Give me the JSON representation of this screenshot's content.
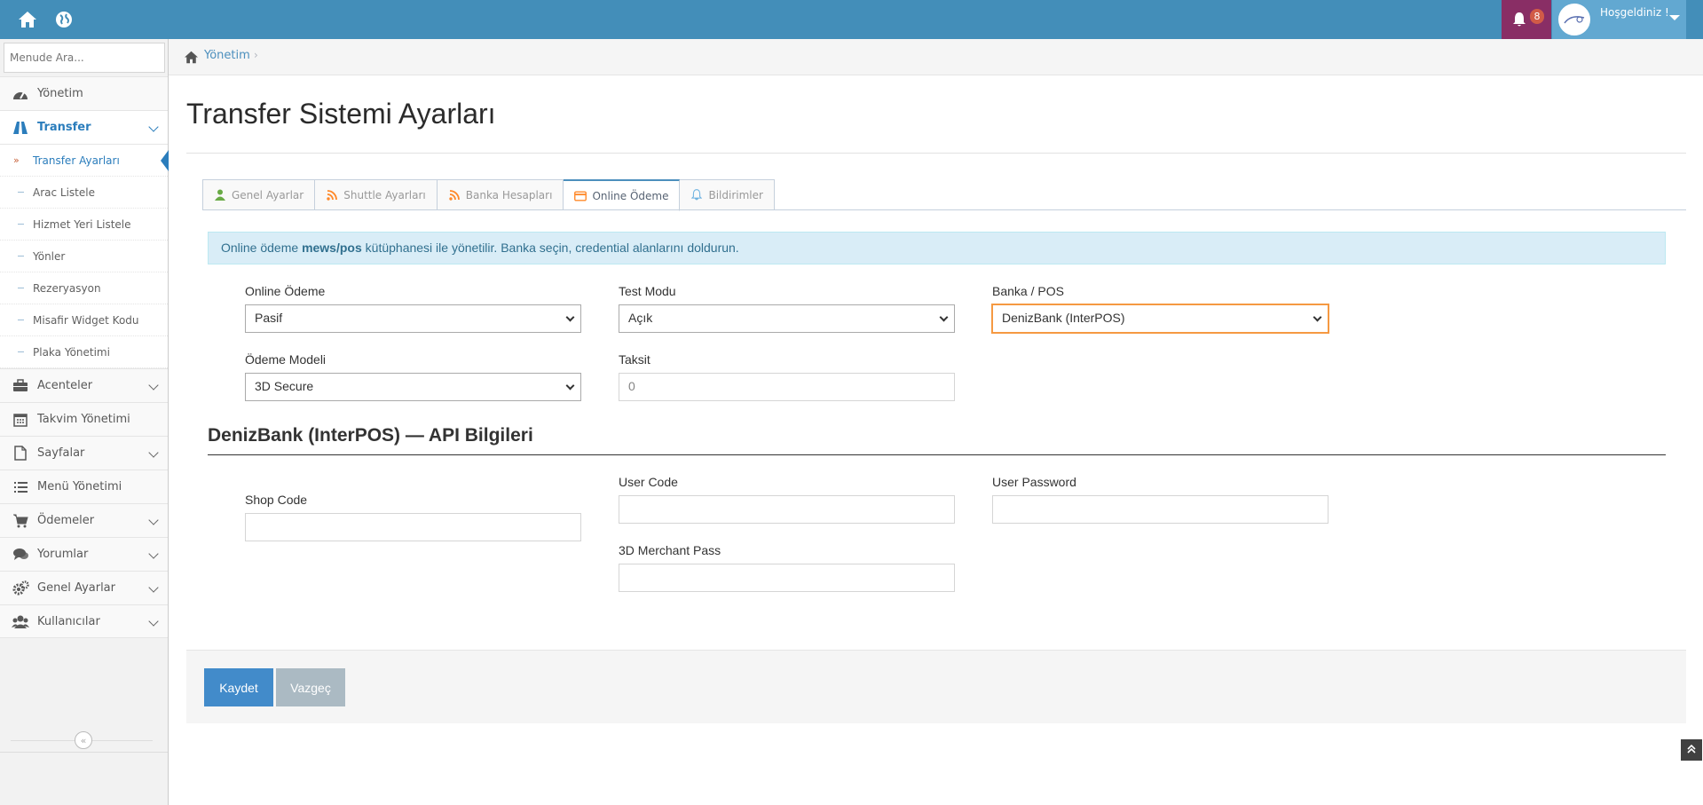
{
  "colors": {
    "navbar": "#438eb9",
    "notification_bg": "#892e65",
    "user_bg": "#62a8d1",
    "accent": "#2b7dbc",
    "alert_bg": "#d9edf7",
    "save_button": "#428bca",
    "cancel_button": "#abbac3"
  },
  "navbar": {
    "home_icon": "home-icon",
    "globe_icon": "globe-icon",
    "notification_count": "8",
    "welcome_text": "Hoşgeldiniz !"
  },
  "sidebar": {
    "search_placeholder": "Menude Ara...",
    "items": [
      {
        "label": "Yönetim",
        "icon": "dashboard-icon"
      },
      {
        "label": "Transfer",
        "icon": "road-icon",
        "active": true
      },
      {
        "label": "Acenteler",
        "icon": "briefcase-icon"
      },
      {
        "label": "Takvim Yönetimi",
        "icon": "calendar-icon"
      },
      {
        "label": "Sayfalar",
        "icon": "file-icon"
      },
      {
        "label": "Menü Yönetimi",
        "icon": "list-icon"
      },
      {
        "label": "Ödemeler",
        "icon": "cart-icon"
      },
      {
        "label": "Yorumlar",
        "icon": "comments-icon"
      },
      {
        "label": "Genel Ayarlar",
        "icon": "cogs-icon"
      },
      {
        "label": "Kullanıcılar",
        "icon": "users-icon"
      }
    ],
    "submenu": [
      {
        "label": "Transfer Ayarları",
        "current": true
      },
      {
        "label": "Arac Listele"
      },
      {
        "label": "Hizmet Yeri Listele"
      },
      {
        "label": "Yönler"
      },
      {
        "label": "Rezeryasyon"
      },
      {
        "label": "Misafir Widget Kodu"
      },
      {
        "label": "Plaka Yönetimi"
      }
    ]
  },
  "breadcrumb": {
    "link": "Yönetim",
    "separator": "›"
  },
  "page": {
    "title": "Transfer Sistemi Ayarları"
  },
  "tabs": [
    {
      "label": "Genel Ayarlar",
      "icon": "user-icon"
    },
    {
      "label": "Shuttle Ayarları",
      "icon": "rss-icon"
    },
    {
      "label": "Banka Hesapları",
      "icon": "rss-icon"
    },
    {
      "label": "Online Ödeme",
      "icon": "credit-card-icon",
      "active": true
    },
    {
      "label": "Bildirimler",
      "icon": "bell-icon"
    }
  ],
  "alert": {
    "prefix": "Online ödeme ",
    "library": "mews/pos",
    "suffix": " kütüphanesi ile yönetilir. Banka seçin, credential alanlarını doldurun."
  },
  "form": {
    "online_payment": {
      "label": "Online Ödeme",
      "value": "Pasif"
    },
    "test_mode": {
      "label": "Test Modu",
      "value": "Açık"
    },
    "bank_pos": {
      "label": "Banka / POS",
      "value": "DenizBank (InterPOS)"
    },
    "payment_model": {
      "label": "Ödeme Modeli",
      "value": "3D Secure"
    },
    "installment": {
      "label": "Taksit",
      "value": "0"
    },
    "api_section_title": "DenizBank (InterPOS) — API Bilgileri",
    "shop_code": {
      "label": "Shop Code",
      "value": ""
    },
    "user_code": {
      "label": "User Code",
      "value": ""
    },
    "user_password": {
      "label": "User Password",
      "value": ""
    },
    "merchant_pass": {
      "label": "3D Merchant Pass",
      "value": ""
    }
  },
  "actions": {
    "save_label": "Kaydet",
    "cancel_label": "Vazgeç"
  }
}
